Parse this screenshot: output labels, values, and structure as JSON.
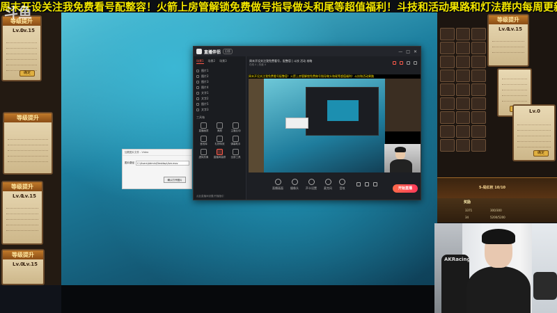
{
  "overlay": {
    "logo_text": "斗鱼",
    "banner_text": "周末开设关注我免费看号配整容！火箭上房管解锁免费做号指导做头和尾等超值福利！斗技和活动果路和灯法群内每周更新"
  },
  "game_cards": {
    "header_upgrade": "等级提升",
    "level_left": "Lv.0",
    "level_right": "Lv.15",
    "upgrade_button": "确定"
  },
  "right_panels": {
    "rank_text": "5-局红枚 10/10",
    "reward_label": "奖励",
    "reward_values": [
      "3371",
      "300/300",
      "34",
      "5200/5200"
    ]
  },
  "app": {
    "name": "直播伴侣",
    "badge": "旧版",
    "window_controls": [
      "—",
      "□",
      "✕"
    ],
    "side_tabs": [
      "场景1",
      "场景2",
      "场景3"
    ],
    "scenes": [
      "图片1",
      "图片2",
      "图片3",
      "图片4",
      "文字1",
      "文字2",
      "图片5",
      "文字3"
    ],
    "tools_title": "工具箱",
    "tools": [
      {
        "label": "直播画质"
      },
      {
        "label": "美颜"
      },
      {
        "label": "主播互动"
      },
      {
        "label": "音效库"
      },
      {
        "label": "礼物特效"
      },
      {
        "label": "弹幕助手"
      },
      {
        "label": "虚拟形象"
      },
      {
        "label": "直播间装修",
        "red": true
      },
      {
        "label": "全部工具"
      }
    ],
    "sidebar_footer": "点此直播间设置/开播指引",
    "stream_title": "周末开设关注我免费看号，配整容 | 斗技 活动 攻略",
    "stream_subtitle": "在线 0  |  热度 0",
    "controls": [
      "直播画面",
      "摄像头",
      "声卡设置",
      "麦克风",
      "音效"
    ],
    "live_button": "开始直播",
    "preview_ticker": "周末开设关注我免费看号配整容！火箭上房管解锁免费做号指导做头和尾等超值福利！斗技和活动果路"
  },
  "dialog": {
    "title": "加载图片文件 - Video",
    "label": "图片路径",
    "path_value": "C:\\Users\\Admin\\Desktop\\live.mov",
    "button": "确认打开图片"
  },
  "webcam": {
    "chair_brand": "AKRacing"
  }
}
